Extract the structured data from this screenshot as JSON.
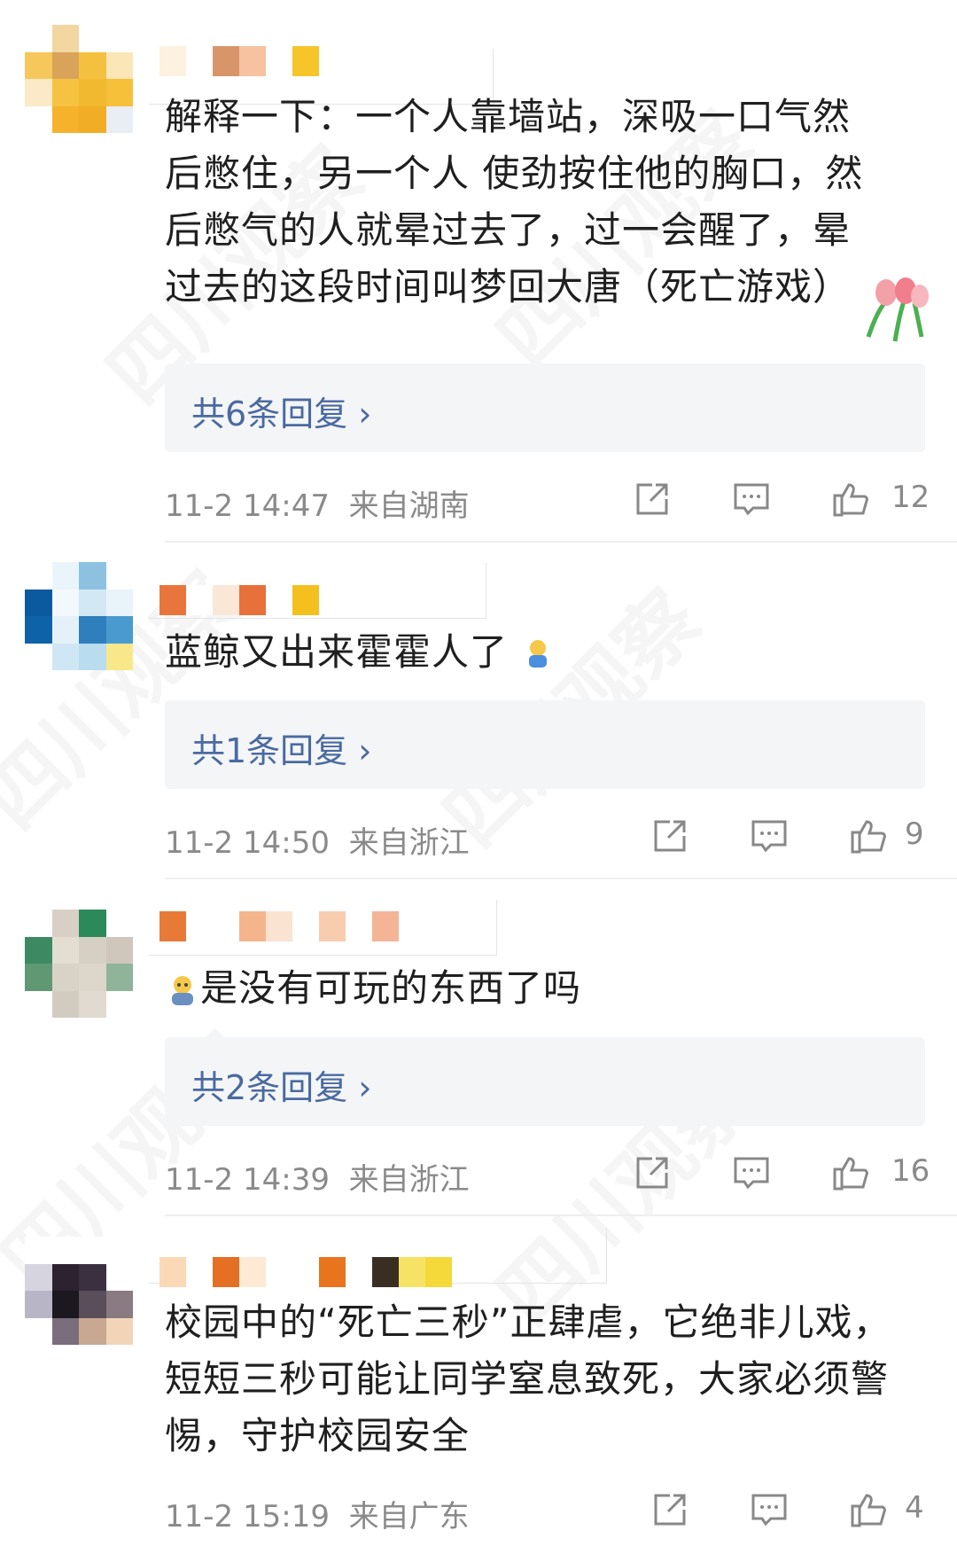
{
  "comments": [
    {
      "text_lines": [
        "解释一下：一个人靠墙站，深吸一口气然",
        "后憋住，另一个人 使劲按住他的胸口，然",
        "后憋气的人就晕过去了，过一会醒了，晕",
        "过去的这段时间叫梦回大唐（死亡游戏）"
      ],
      "replies_label": "共6条回复 ›",
      "time": "11-2 14:47",
      "location": "来自湖南",
      "likes": "12"
    },
    {
      "text_lines": [
        "蓝鲸又出来霍霍人了"
      ],
      "replies_label": "共1条回复 ›",
      "time": "11-2 14:50",
      "location": "来自浙江",
      "likes": "9"
    },
    {
      "text_lines": [
        "是没有可玩的东西了吗"
      ],
      "replies_label": "共2条回复 ›",
      "time": "11-2 14:39",
      "location": "来自浙江",
      "likes": "16"
    },
    {
      "text_lines": [
        "校园中的“死亡三秒”正肆虐，它绝非儿戏，",
        "短短三秒可能让同学窒息致死，大家必须警",
        "惕，守护校园安全"
      ],
      "time": "11-2 15:19",
      "location": "来自广东",
      "likes": "4"
    }
  ],
  "watermark": "四川观察",
  "icons": {
    "repost": "share-icon",
    "comment": "comment-icon",
    "like": "thumbs-up-icon"
  },
  "colors": {
    "link": "#4a6aa0",
    "meta": "#8a8a8a",
    "reply_bg": "#f4f5f7"
  }
}
